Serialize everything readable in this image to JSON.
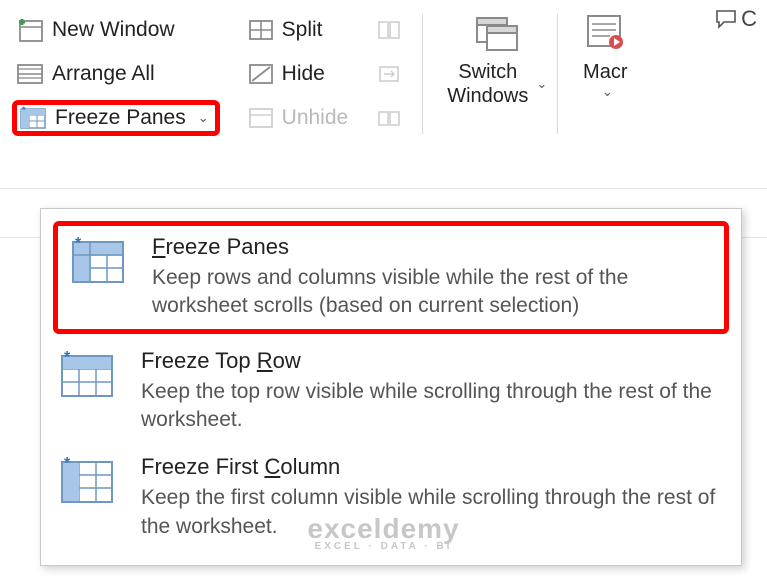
{
  "topright": {
    "label": "C"
  },
  "ribbon": {
    "col1": {
      "new_window": "New Window",
      "arrange_all": "Arrange All",
      "freeze_panes": "Freeze Panes"
    },
    "col2": {
      "split": "Split",
      "hide": "Hide",
      "unhide": "Unhide"
    },
    "switch_windows": "Switch\nWindows",
    "macros": "Macr"
  },
  "menu": {
    "items": [
      {
        "title": "Freeze Panes",
        "underline_char": "F",
        "desc": "Keep rows and columns visible while the rest of the worksheet scrolls (based on current selection)",
        "highlighted": true
      },
      {
        "title": "Freeze Top Row",
        "underline_char": "R",
        "desc": "Keep the top row visible while scrolling through the rest of the worksheet.",
        "highlighted": false
      },
      {
        "title": "Freeze First Column",
        "underline_char": "C",
        "desc": "Keep the first column visible while scrolling through the rest of the worksheet.",
        "highlighted": false
      }
    ]
  },
  "watermark": {
    "line1": "exceldemy",
    "line2": "EXCEL · DATA · BI"
  }
}
